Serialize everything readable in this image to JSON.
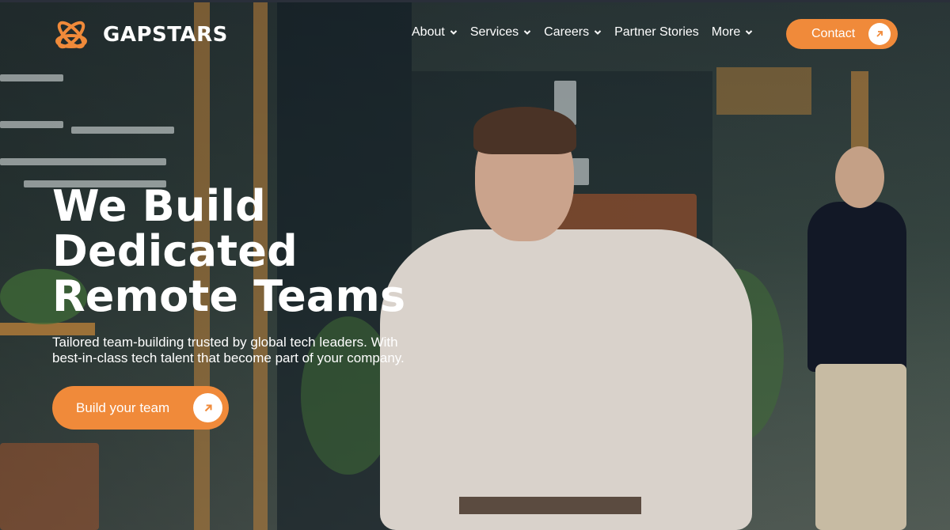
{
  "brand": {
    "name": "GAPSTARS",
    "accent": "#f08a3a"
  },
  "nav": {
    "items": [
      {
        "label": "About",
        "has_dropdown": true
      },
      {
        "label": "Services",
        "has_dropdown": true
      },
      {
        "label": "Careers",
        "has_dropdown": true
      },
      {
        "label": "Partner Stories",
        "has_dropdown": false
      },
      {
        "label": "More",
        "has_dropdown": true
      }
    ],
    "contact_label": "Contact"
  },
  "hero": {
    "headline_lines": [
      "We Build",
      "Dedicated",
      "Remote Teams"
    ],
    "subtitle_lines": [
      "Tailored team-building trusted by global tech leaders. With",
      "best-in-class tech talent that become part of your company."
    ],
    "cta_label": "Build your team"
  },
  "icons": {
    "logo": "atom-logo-icon",
    "dropdown": "chevron-down-icon",
    "button_arrow": "arrow-up-right-icon"
  }
}
